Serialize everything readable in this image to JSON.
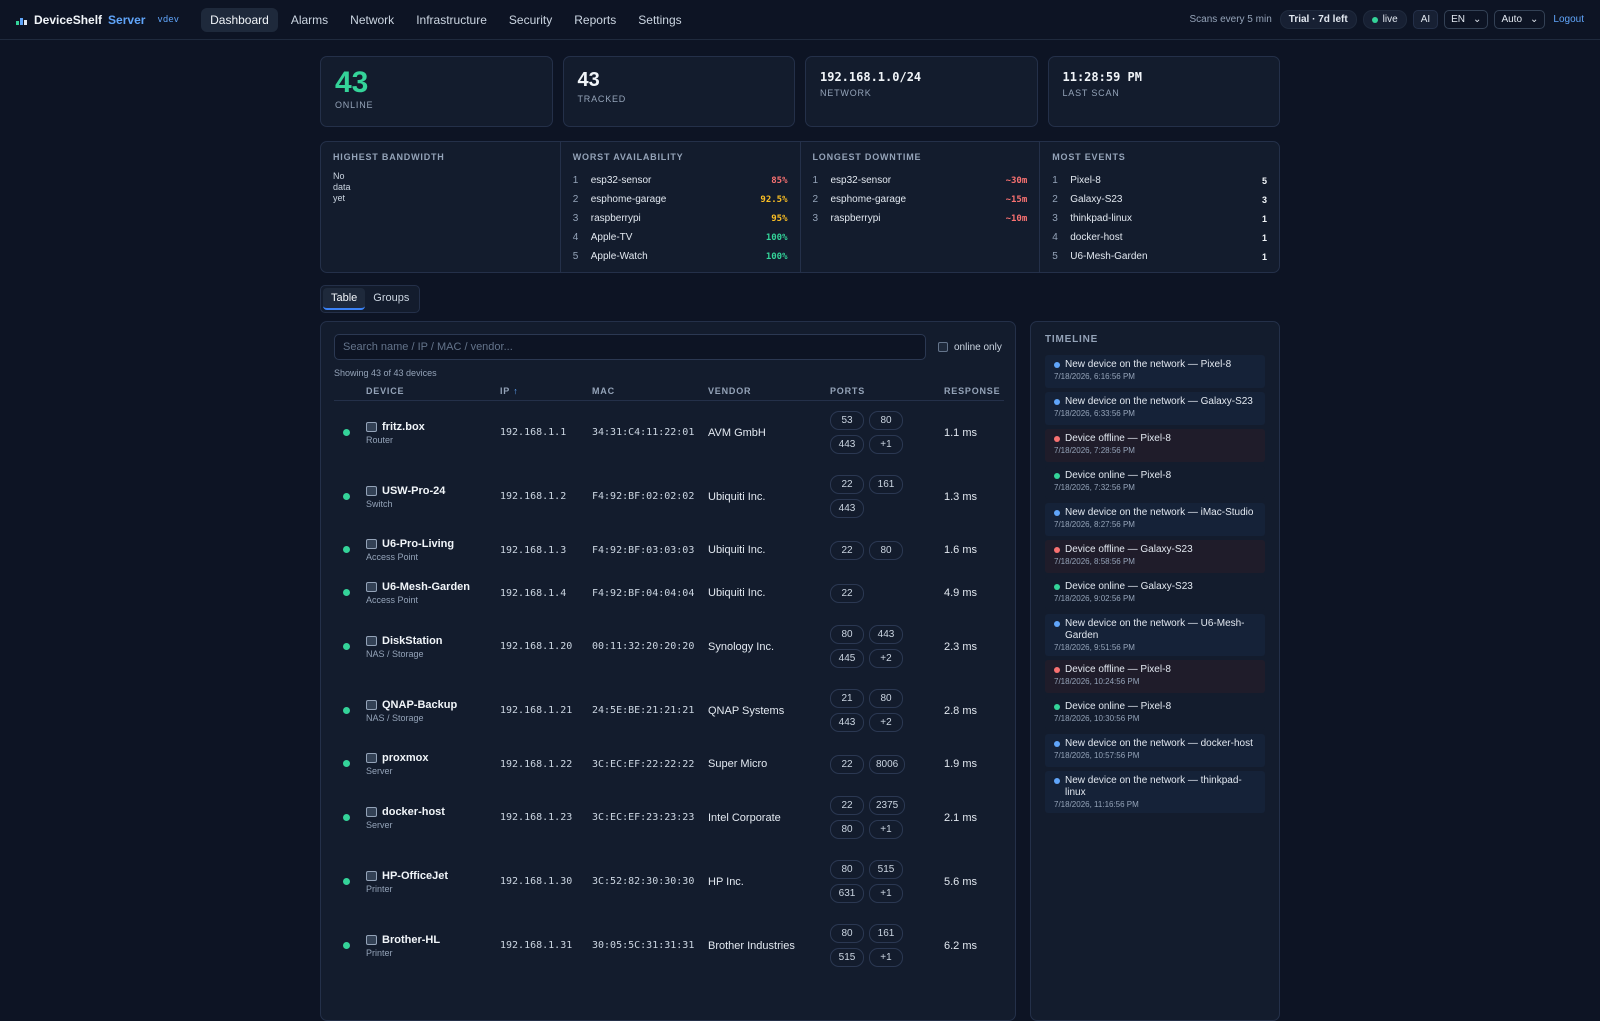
{
  "header": {
    "brand": "DeviceShelf",
    "brand_suffix": "Server",
    "version": "vdev",
    "nav": [
      {
        "label": "Dashboard",
        "active": true
      },
      {
        "label": "Alarms"
      },
      {
        "label": "Network"
      },
      {
        "label": "Infrastructure"
      },
      {
        "label": "Security"
      },
      {
        "label": "Reports"
      },
      {
        "label": "Settings"
      }
    ],
    "scan_text": "Scans every 5 min",
    "trial": "Trial · 7d left",
    "live": "live",
    "ai": "AI",
    "lang": "EN",
    "theme": "Auto",
    "logout": "Logout"
  },
  "stats": [
    {
      "value": "43",
      "label": "ONLINE",
      "color": "#34d399",
      "size": "big"
    },
    {
      "value": "43",
      "label": "TRACKED",
      "color": "#f1f5f9",
      "size": "mid"
    },
    {
      "value": "192.168.1.0/24",
      "label": "NETWORK",
      "color": "#f1f5f9",
      "size": "mono"
    },
    {
      "value": "11:28:59 PM",
      "label": "LAST SCAN",
      "color": "#f1f5f9",
      "size": "mono"
    }
  ],
  "panels": {
    "bandwidth": {
      "title": "HIGHEST BANDWIDTH",
      "empty": "No data yet"
    },
    "availability": {
      "title": "WORST AVAILABILITY",
      "rows": [
        {
          "n": "1",
          "name": "esp32-sensor",
          "val": "85%",
          "color": "#f87171"
        },
        {
          "n": "2",
          "name": "esphome-garage",
          "val": "92.5%",
          "color": "#fbbf24"
        },
        {
          "n": "3",
          "name": "raspberrypi",
          "val": "95%",
          "color": "#fbbf24"
        },
        {
          "n": "4",
          "name": "Apple-TV",
          "val": "100%",
          "color": "#34d399"
        },
        {
          "n": "5",
          "name": "Apple-Watch",
          "val": "100%",
          "color": "#34d399"
        }
      ]
    },
    "downtime": {
      "title": "LONGEST DOWNTIME",
      "rows": [
        {
          "n": "1",
          "name": "esp32-sensor",
          "val": "~30m",
          "color": "#f87171"
        },
        {
          "n": "2",
          "name": "esphome-garage",
          "val": "~15m",
          "color": "#f87171"
        },
        {
          "n": "3",
          "name": "raspberrypi",
          "val": "~10m",
          "color": "#f87171"
        }
      ]
    },
    "events": {
      "title": "MOST EVENTS",
      "rows": [
        {
          "n": "1",
          "name": "Pixel-8",
          "val": "5",
          "color": "#f1f5f9"
        },
        {
          "n": "2",
          "name": "Galaxy-S23",
          "val": "3",
          "color": "#f1f5f9"
        },
        {
          "n": "3",
          "name": "thinkpad-linux",
          "val": "1",
          "color": "#f1f5f9"
        },
        {
          "n": "4",
          "name": "docker-host",
          "val": "1",
          "color": "#f1f5f9"
        },
        {
          "n": "5",
          "name": "U6-Mesh-Garden",
          "val": "1",
          "color": "#f1f5f9"
        }
      ]
    }
  },
  "tabs": [
    {
      "label": "Table",
      "active": true
    },
    {
      "label": "Groups"
    }
  ],
  "devices_table": {
    "search_placeholder": "Search name / IP / MAC / vendor...",
    "online_only": "online only",
    "showing": "Showing 43 of 43 devices",
    "columns": [
      "DEVICE",
      "IP ↑",
      "MAC",
      "VENDOR",
      "PORTS",
      "RESPONSE"
    ],
    "rows": [
      {
        "name": "fritz.box",
        "type": "Router",
        "icon": "router-icon",
        "ip": "192.168.1.1",
        "mac": "34:31:C4:11:22:01",
        "vendor": "AVM GmbH",
        "ports": [
          "53",
          "80",
          "443",
          "+1"
        ],
        "response": "1.1 ms"
      },
      {
        "name": "USW-Pro-24",
        "type": "Switch",
        "icon": "switch-icon",
        "ip": "192.168.1.2",
        "mac": "F4:92:BF:02:02:02",
        "vendor": "Ubiquiti Inc.",
        "ports": [
          "22",
          "161",
          "443"
        ],
        "response": "1.3 ms"
      },
      {
        "name": "U6-Pro-Living",
        "type": "Access Point",
        "icon": "access-point-icon",
        "ip": "192.168.1.3",
        "mac": "F4:92:BF:03:03:03",
        "vendor": "Ubiquiti Inc.",
        "ports": [
          "22",
          "80"
        ],
        "response": "1.6 ms"
      },
      {
        "name": "U6-Mesh-Garden",
        "type": "Access Point",
        "icon": "access-point-icon",
        "ip": "192.168.1.4",
        "mac": "F4:92:BF:04:04:04",
        "vendor": "Ubiquiti Inc.",
        "ports": [
          "22"
        ],
        "response": "4.9 ms"
      },
      {
        "name": "DiskStation",
        "type": "NAS / Storage",
        "icon": "nas-icon",
        "ip": "192.168.1.20",
        "mac": "00:11:32:20:20:20",
        "vendor": "Synology Inc.",
        "ports": [
          "80",
          "443",
          "445",
          "+2"
        ],
        "response": "2.3 ms"
      },
      {
        "name": "QNAP-Backup",
        "type": "NAS / Storage",
        "icon": "nas-icon",
        "ip": "192.168.1.21",
        "mac": "24:5E:BE:21:21:21",
        "vendor": "QNAP Systems",
        "ports": [
          "21",
          "80",
          "443",
          "+2"
        ],
        "response": "2.8 ms"
      },
      {
        "name": "proxmox",
        "type": "Server",
        "icon": "server-icon",
        "ip": "192.168.1.22",
        "mac": "3C:EC:EF:22:22:22",
        "vendor": "Super Micro",
        "ports": [
          "22",
          "8006"
        ],
        "response": "1.9 ms"
      },
      {
        "name": "docker-host",
        "type": "Server",
        "icon": "server-icon",
        "ip": "192.168.1.23",
        "mac": "3C:EC:EF:23:23:23",
        "vendor": "Intel Corporate",
        "ports": [
          "22",
          "2375",
          "80",
          "+1"
        ],
        "response": "2.1 ms"
      },
      {
        "name": "HP-OfficeJet",
        "type": "Printer",
        "icon": "printer-icon",
        "ip": "192.168.1.30",
        "mac": "3C:52:82:30:30:30",
        "vendor": "HP Inc.",
        "ports": [
          "80",
          "515",
          "631",
          "+1"
        ],
        "response": "5.6 ms"
      },
      {
        "name": "Brother-HL",
        "type": "Printer",
        "icon": "printer-icon",
        "ip": "192.168.1.31",
        "mac": "30:05:5C:31:31:31",
        "vendor": "Brother Industries",
        "ports": [
          "80",
          "161",
          "515",
          "+1"
        ],
        "response": "6.2 ms"
      }
    ]
  },
  "timeline": {
    "title": "TIMELINE",
    "items": [
      {
        "kind": "new",
        "msg": "New device on the network — Pixel-8",
        "time": "7/18/2026, 6:16:56 PM"
      },
      {
        "kind": "new",
        "msg": "New device on the network — Galaxy-S23",
        "time": "7/18/2026, 6:33:56 PM"
      },
      {
        "kind": "offline",
        "msg": "Device offline — Pixel-8",
        "time": "7/18/2026, 7:28:56 PM"
      },
      {
        "kind": "online",
        "msg": "Device online — Pixel-8",
        "time": "7/18/2026, 7:32:56 PM"
      },
      {
        "kind": "new",
        "msg": "New device on the network — iMac-Studio",
        "time": "7/18/2026, 8:27:56 PM"
      },
      {
        "kind": "offline",
        "msg": "Device offline — Galaxy-S23",
        "time": "7/18/2026, 8:58:56 PM"
      },
      {
        "kind": "online",
        "msg": "Device online — Galaxy-S23",
        "time": "7/18/2026, 9:02:56 PM"
      },
      {
        "kind": "new",
        "msg": "New device on the network — U6-Mesh-Garden",
        "time": "7/18/2026, 9:51:56 PM"
      },
      {
        "kind": "offline",
        "msg": "Device offline — Pixel-8",
        "time": "7/18/2026, 10:24:56 PM"
      },
      {
        "kind": "online",
        "msg": "Device online — Pixel-8",
        "time": "7/18/2026, 10:30:56 PM"
      },
      {
        "kind": "new",
        "msg": "New device on the network — docker-host",
        "time": "7/18/2026, 10:57:56 PM"
      },
      {
        "kind": "new",
        "msg": "New device on the network — thinkpad-linux",
        "time": "7/18/2026, 11:16:56 PM"
      }
    ]
  },
  "colors": {
    "new": "#60a5fa",
    "offline": "#f87171",
    "online": "#34d399",
    "accent": "#3b82f6"
  }
}
